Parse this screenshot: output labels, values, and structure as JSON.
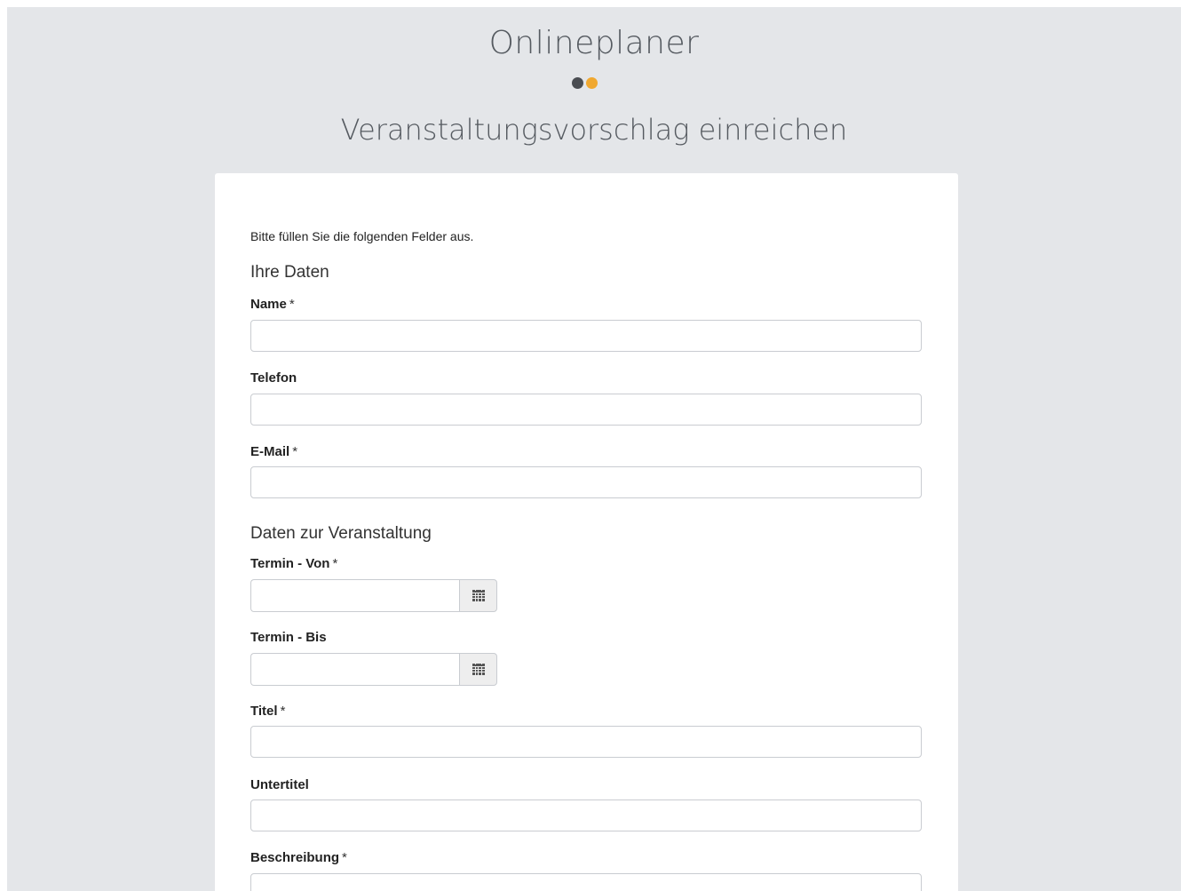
{
  "header": {
    "app_title": "Onlineplaner",
    "logo_dot_colors": [
      "#4a4d52",
      "#f0a830"
    ],
    "page_title": "Veranstaltungsvorschlag einreichen"
  },
  "form": {
    "intro": "Bitte füllen Sie die folgenden Felder aus.",
    "section_personal": "Ihre Daten",
    "section_event": "Daten zur Veranstaltung",
    "required_marker": "*",
    "fields": {
      "name": {
        "label": "Name",
        "value": ""
      },
      "telefon": {
        "label": "Telefon",
        "value": ""
      },
      "email": {
        "label": "E-Mail",
        "value": ""
      },
      "termin_von": {
        "label": "Termin - Von",
        "value": ""
      },
      "termin_bis": {
        "label": "Termin - Bis",
        "value": ""
      },
      "titel": {
        "label": "Titel",
        "value": ""
      },
      "untertitel": {
        "label": "Untertitel",
        "value": ""
      },
      "beschreibung": {
        "label": "Beschreibung",
        "value": ""
      }
    },
    "date_picker_icon": "calendar-icon"
  },
  "colors": {
    "background": "#e4e6e9",
    "card": "#ffffff",
    "input_border": "#c9ccd1",
    "addon_background": "#eeeeee"
  }
}
